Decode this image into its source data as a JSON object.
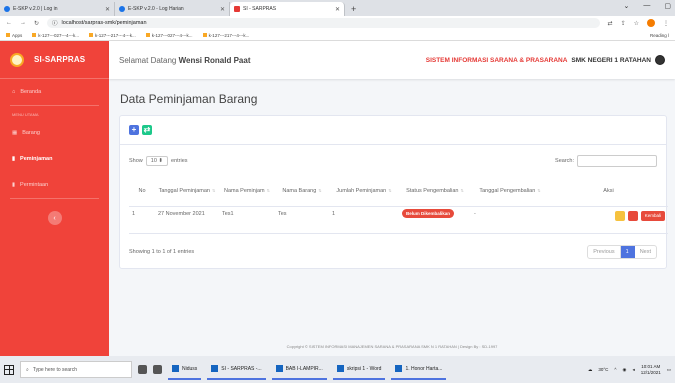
{
  "browser": {
    "tabs": [
      {
        "title": "E-SKP v.2.0 | Log in",
        "active": false
      },
      {
        "title": "E-SKP v.2.0 - Log Harian",
        "active": false
      },
      {
        "title": "SI - SARPRAS",
        "active": true
      }
    ],
    "url": "localhost/sarpras-smk/peminjaman",
    "bookmarks": [
      "Apps",
      "k-127---027---4---k...",
      "k-127---217---4---k...",
      "k-127---027---4---k...",
      "k-127---217---4---k..."
    ],
    "reading_list": "Reading l"
  },
  "sidebar": {
    "brand": "SI-SARPRAS",
    "items": [
      {
        "label": "Beranda",
        "icon": "home-icon"
      },
      {
        "label": "Barang",
        "icon": "table-icon"
      },
      {
        "label": "Peminjaman",
        "icon": "file-icon",
        "active": true
      },
      {
        "label": "Permintaan",
        "icon": "file-icon"
      }
    ],
    "section_label": "MENU UTAMA"
  },
  "topbar": {
    "welcome_prefix": "Selamat Datang",
    "user_name": "Wensi Ronald Paat",
    "system_name": "SISTEM INFORMASI SARANA & PRASARANA",
    "school_name": "SMK NEGERI 1 RATAHAN"
  },
  "page": {
    "title": "Data Peminjaman Barang"
  },
  "table_controls": {
    "show_label": "Show",
    "entries_value": "10",
    "entries_label": "entries",
    "search_label": "Search:"
  },
  "table": {
    "headers": [
      "No",
      "Tanggal Peminjaman",
      "Nama Peminjam",
      "Nama Barang",
      "Jumlah Peminjaman",
      "Status Pengembalian",
      "Tanggal Pengembalian",
      "Aksi"
    ],
    "rows": [
      {
        "no": "1",
        "tanggal": "27 November 2021",
        "peminjam": "Tes1",
        "barang": "Tes",
        "jumlah": "1",
        "status": "Belum Dikembalikan",
        "tgl_kembali": "-",
        "aksi_label": "Kembali"
      }
    ]
  },
  "footer_info": "Showing 1 to 1 of 1 entries",
  "pagination": {
    "previous": "Previous",
    "current": "1",
    "next": "Next"
  },
  "copyright": "Copyright © SISTEM INFORMASI MANAJEMEN SARANA & PRASARANA SMK N 1 RATAHAN | Design By : SD-1997",
  "taskbar": {
    "search_placeholder": "Type here to search",
    "apps": [
      "Niduss",
      "SI - SARPRAS -...",
      "BAB I-LAMPIR...",
      "skripsi 1 - Word",
      "1. Honor Harta..."
    ],
    "weather": "30°C",
    "time": "10:01 AM",
    "date": "12/1/2021"
  },
  "colors": {
    "sidebar": "#f0433a",
    "primary": "#4e73df",
    "success": "#1cc88a",
    "danger": "#e74a3b",
    "warning": "#f6c23e"
  }
}
